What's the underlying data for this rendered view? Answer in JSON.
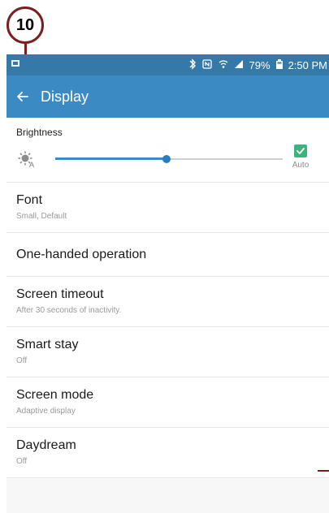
{
  "callout": {
    "number": "10"
  },
  "statusbar": {
    "battery": "79%",
    "time": "2:50 PM"
  },
  "header": {
    "title": "Display"
  },
  "brightness": {
    "label": "Brightness",
    "auto_label": "Auto",
    "level": 0.49
  },
  "settings": [
    {
      "title": "Font",
      "subtitle": "Small, Default"
    },
    {
      "title": "One-handed operation",
      "subtitle": ""
    },
    {
      "title": "Screen timeout",
      "subtitle": "After 30 seconds of inactivity."
    },
    {
      "title": "Smart stay",
      "subtitle": "Off"
    },
    {
      "title": "Screen mode",
      "subtitle": "Adaptive display"
    },
    {
      "title": "Daydream",
      "subtitle": "Off"
    }
  ],
  "colors": {
    "statusbar": "#3579a8",
    "actionbar": "#3b8ac4",
    "callout": "#7a1f1f",
    "check": "#3fb37f"
  },
  "icons": {
    "back": "back-arrow-icon",
    "brightness": "brightness-auto-icon",
    "check": "check-icon",
    "bluetooth": "bluetooth-icon",
    "nfc": "nfc-icon",
    "wifi": "wifi-icon",
    "signal": "signal-icon",
    "battery": "battery-icon",
    "notification": "notification-icon"
  }
}
